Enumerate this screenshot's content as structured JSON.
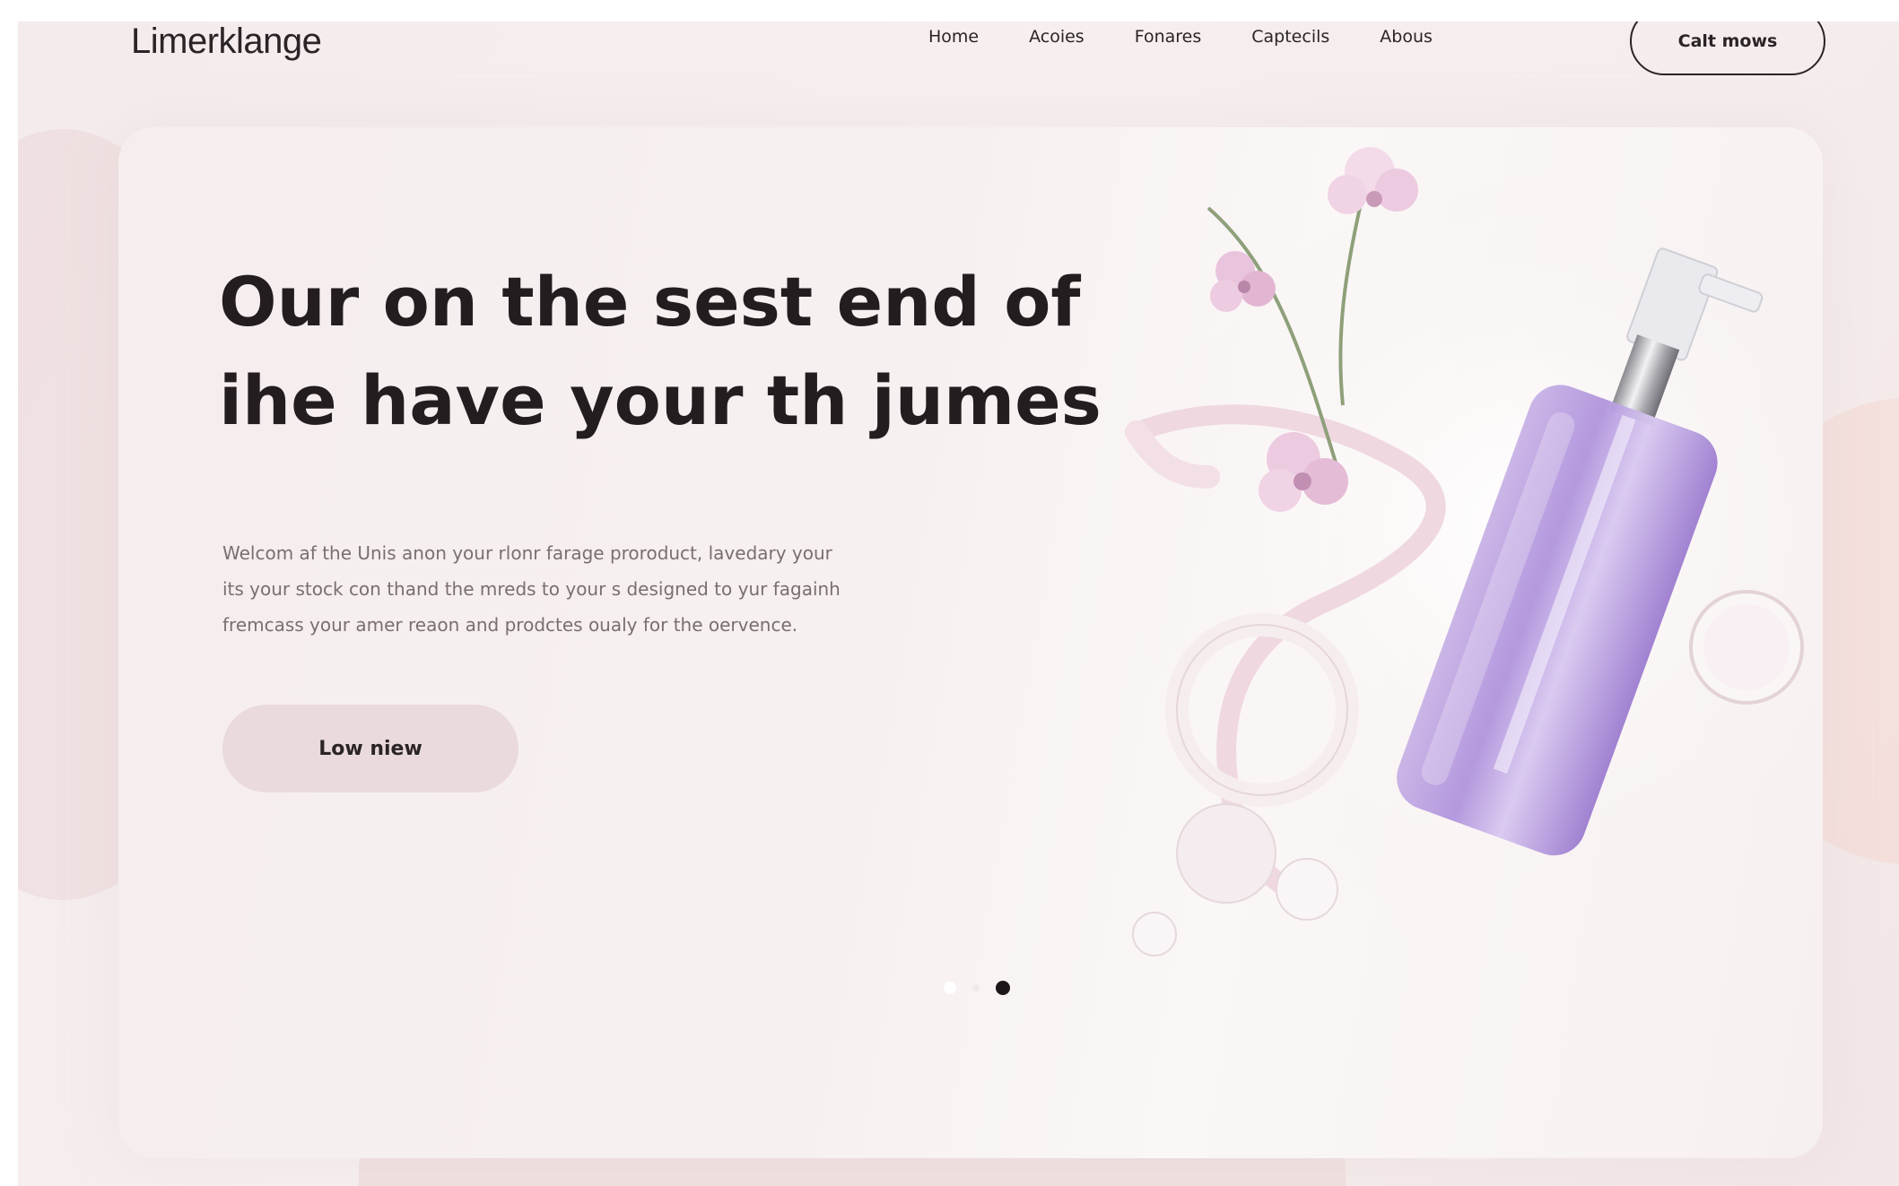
{
  "brand": {
    "logo_text": "Limerklange"
  },
  "nav": {
    "items": [
      "Home",
      "Acoies",
      "Fonares",
      "Captecils",
      "Abous"
    ],
    "cta_label": "Calt mows"
  },
  "hero": {
    "headline_lines": [
      "Our on the sest end of",
      "ihe have your th jumes"
    ],
    "body_lines": [
      "Welcom af the Unis anon your rlonr farage proroduct, lavedary your",
      "its your stock con thand the mreds to your s designed to yur fagainh",
      "fremcass your amer reaon and prodctes oualy for the oervence."
    ],
    "button_label": "Low niew"
  },
  "carousel": {
    "slide_count": 3,
    "active_index": 2
  },
  "colors": {
    "background": "#f4ecec",
    "text_dark": "#241d1f",
    "text_muted": "#7a6e70",
    "button_bg": "#eadadb",
    "bottle": "#b49ad8",
    "flower": "#e8c2dc"
  },
  "icons": {
    "product": "serum-bottle-illustration"
  }
}
